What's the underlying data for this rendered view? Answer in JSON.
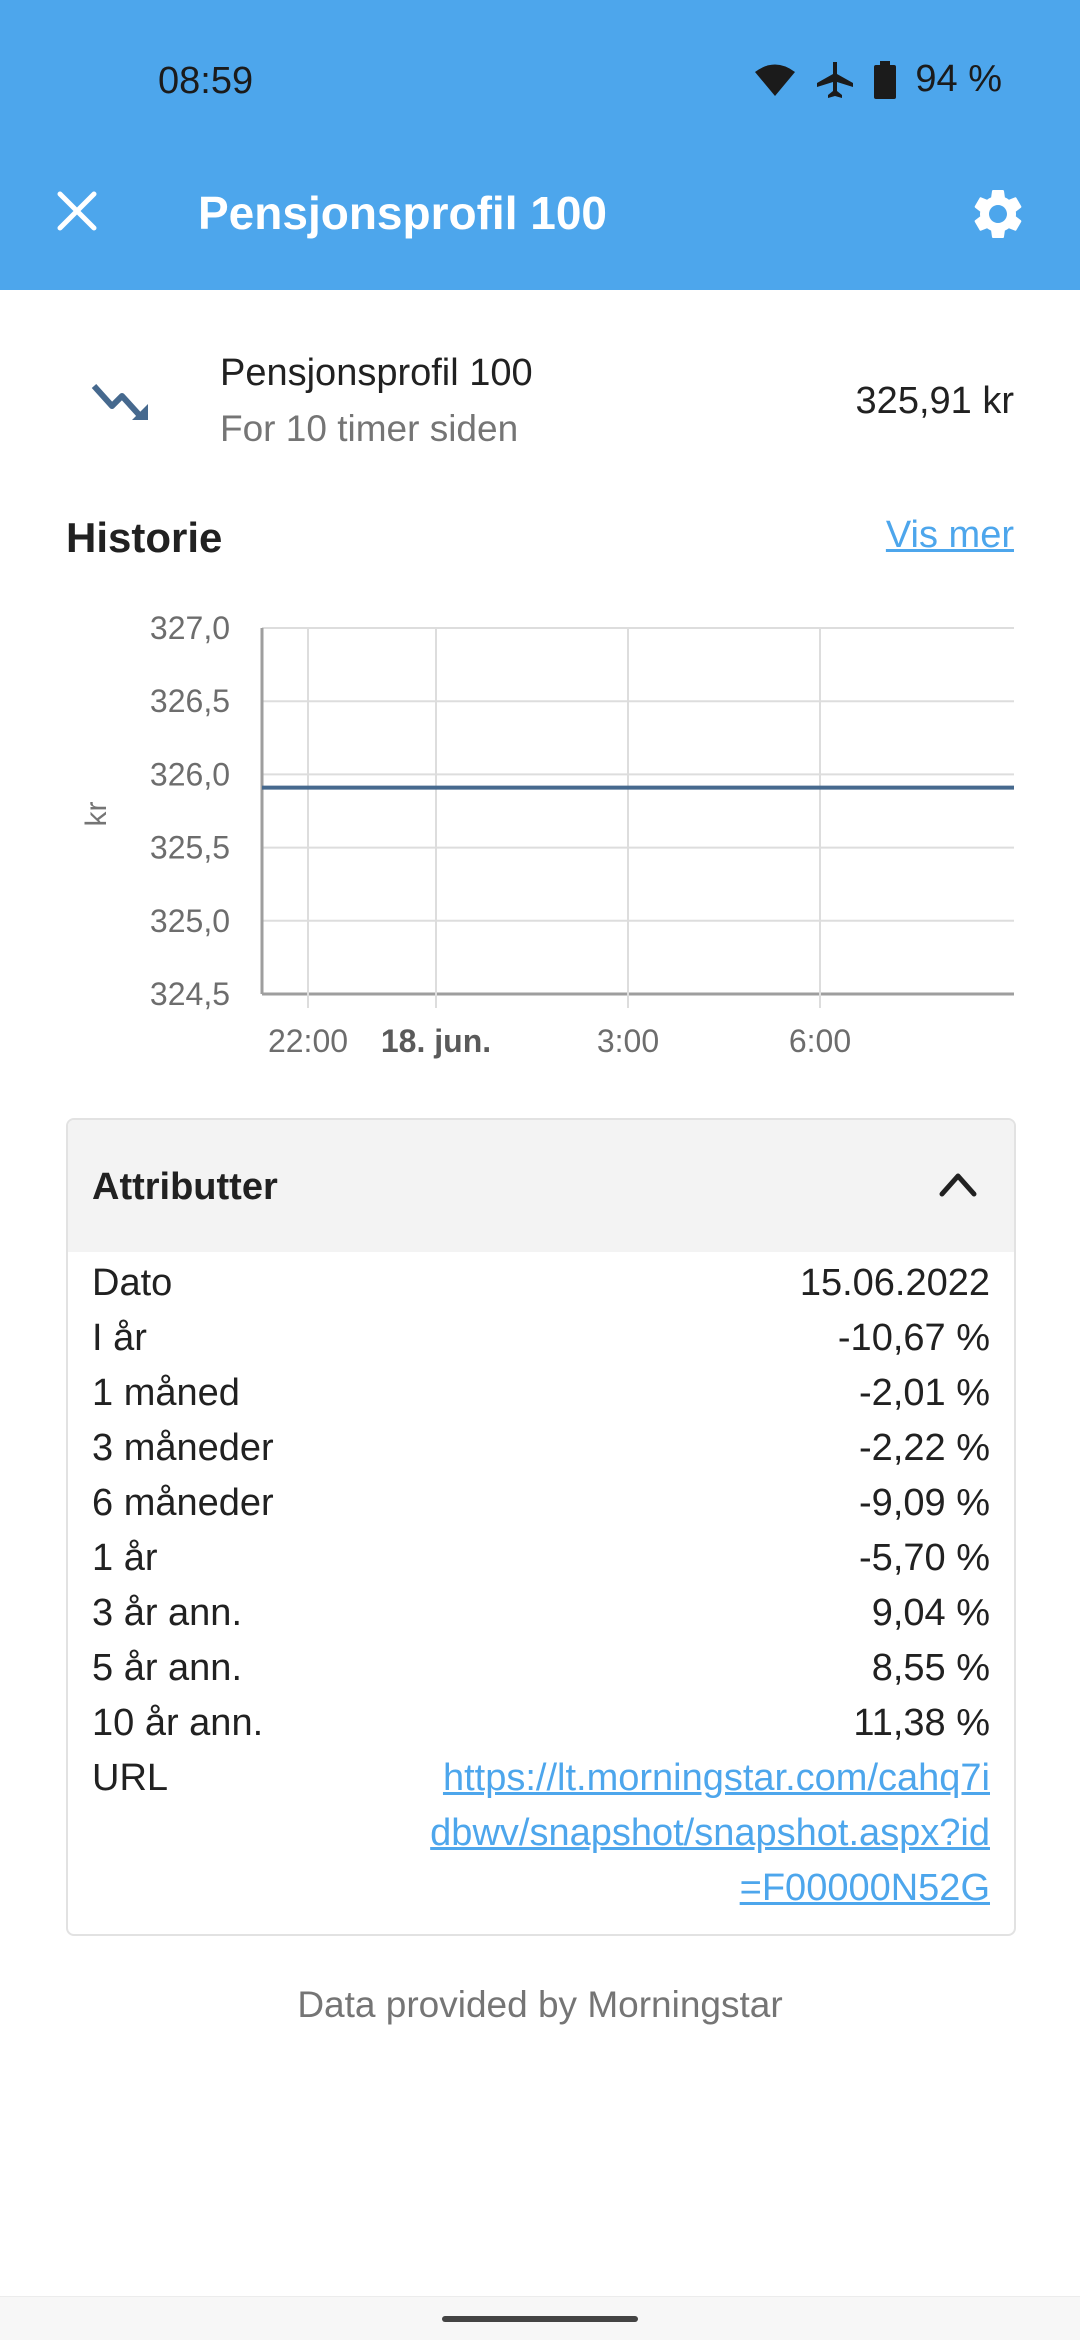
{
  "status_bar": {
    "time": "08:59",
    "battery": "94 %",
    "icons": [
      "wifi-icon",
      "airplane-icon",
      "battery-icon"
    ]
  },
  "app_bar": {
    "title": "Pensjonsprofil 100",
    "close_icon": "close-icon",
    "settings_icon": "gear-icon",
    "color": "#4da6ec"
  },
  "summary": {
    "name": "Pensjonsprofil 100",
    "updated": "For 10 timer siden",
    "value": "325,91 kr",
    "trend_icon": "trending-down-icon"
  },
  "history": {
    "title": "Historie",
    "show_more": "Vis mer"
  },
  "chart_data": {
    "type": "line",
    "ylabel": "kr",
    "ylim": [
      324.5,
      327.0
    ],
    "y_ticks": [
      "327,0",
      "326,5",
      "326,0",
      "325,5",
      "325,0",
      "324,5"
    ],
    "x_ticks": [
      "22:00",
      "18. jun.",
      "3:00",
      "6:00"
    ],
    "series": [
      {
        "values": [
          325.91,
          325.91
        ]
      }
    ],
    "line_color": "#46698e",
    "grid": true
  },
  "attributes": {
    "title": "Attributter",
    "chevron_icon": "chevron-up-icon",
    "rows": [
      {
        "label": "Dato",
        "value": "15.06.2022"
      },
      {
        "label": "I år",
        "value": "-10,67 %"
      },
      {
        "label": "1 måned",
        "value": "-2,01 %"
      },
      {
        "label": "3 måneder",
        "value": "-2,22 %"
      },
      {
        "label": "6 måneder",
        "value": "-9,09 %"
      },
      {
        "label": "1 år",
        "value": "-5,70 %"
      },
      {
        "label": "3 år ann.",
        "value": "9,04 %"
      },
      {
        "label": "5 år ann.",
        "value": "8,55 %"
      },
      {
        "label": "10 år ann.",
        "value": "11,38 %"
      }
    ],
    "url_label": "URL",
    "url": "https://lt.morningstar.com/cahq7idbwv/snapshot/snapshot.aspx?id=F00000N52G"
  },
  "footer": {
    "note": "Data provided by Morningstar"
  }
}
